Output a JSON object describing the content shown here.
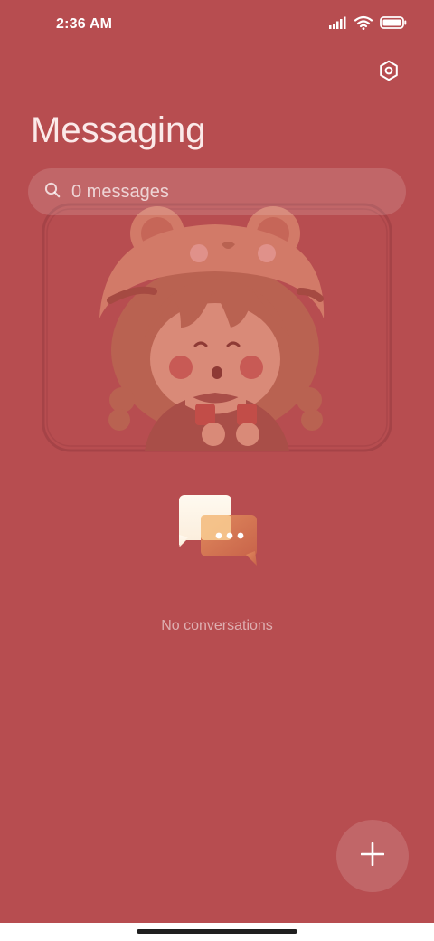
{
  "status_bar": {
    "time": "2:36 AM",
    "icons": [
      "signal-icon",
      "wifi-icon",
      "battery-icon"
    ]
  },
  "header": {
    "title": "Messaging",
    "settings_icon": "settings-icon"
  },
  "search": {
    "text": "0 messages",
    "icon": "search-icon"
  },
  "empty_state": {
    "message": "No conversations",
    "icon": "conversation-bubbles-icon"
  },
  "fab": {
    "icon": "plus-icon"
  },
  "colors": {
    "background": "#b74d50",
    "text_light": "#fbe9e9",
    "bubble_front": "#fdf5e4",
    "bubble_back": "#d97a53"
  }
}
